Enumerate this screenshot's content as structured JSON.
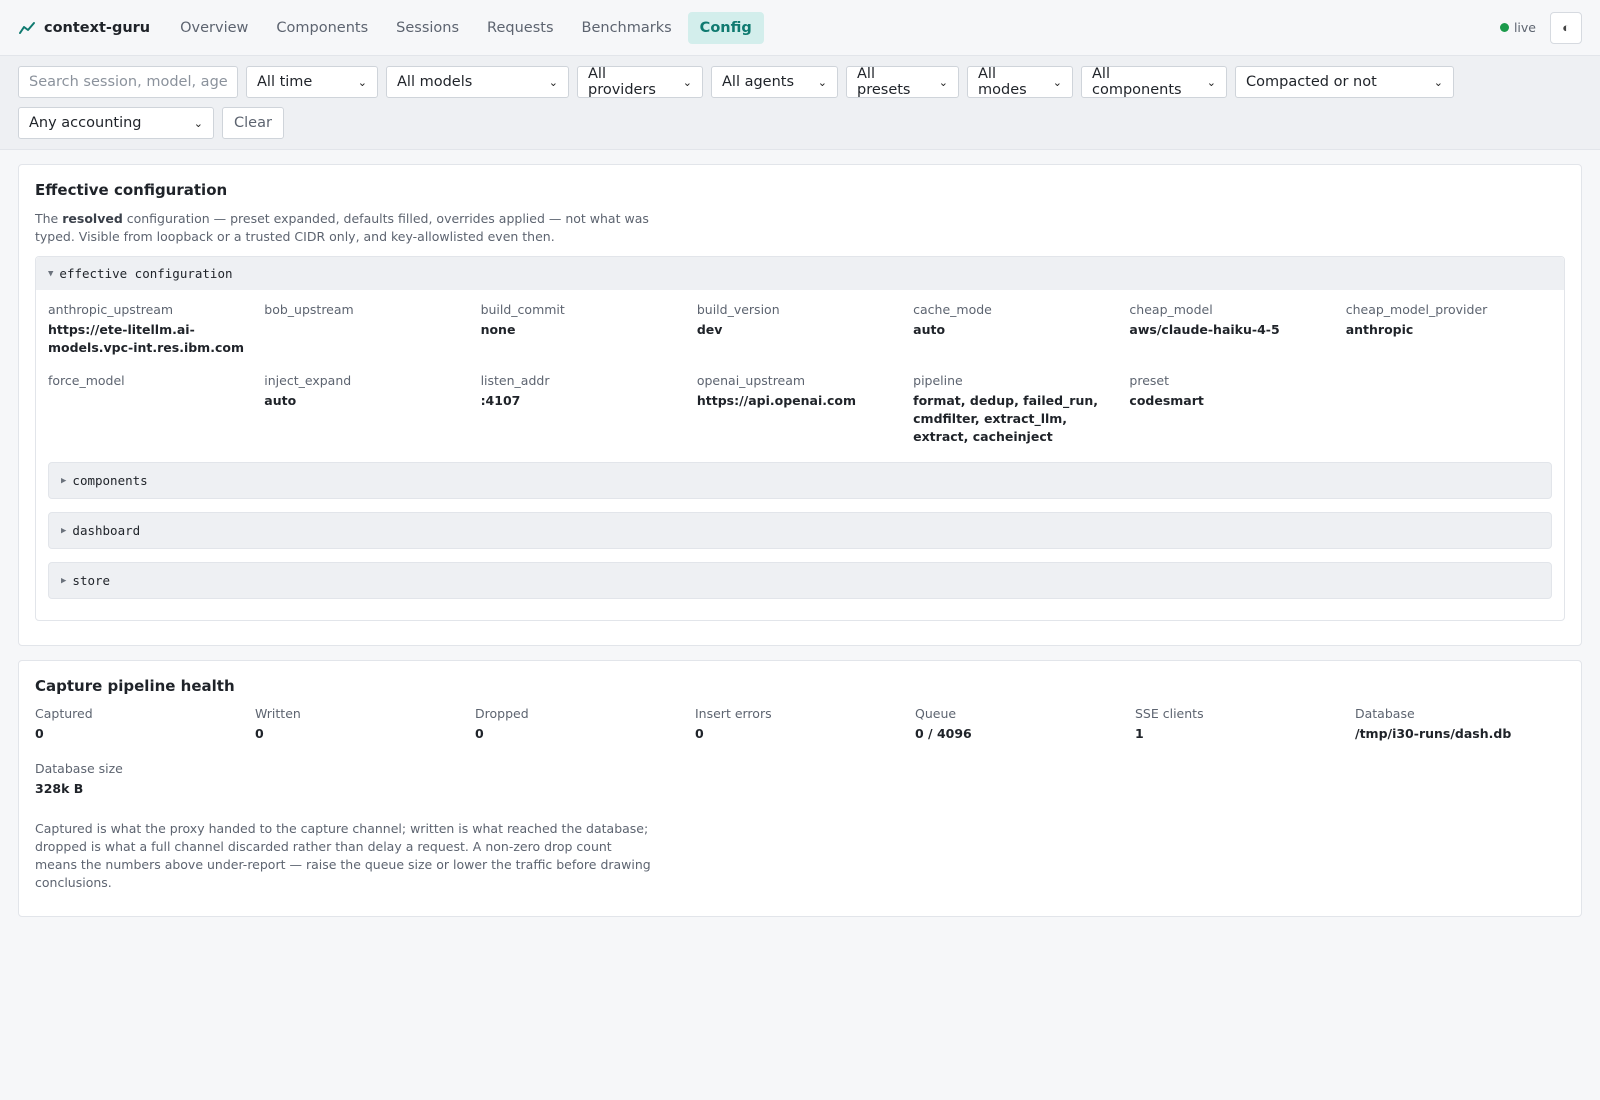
{
  "app": {
    "name": "context-guru"
  },
  "nav": [
    {
      "label": "Overview",
      "active": false
    },
    {
      "label": "Components",
      "active": false
    },
    {
      "label": "Sessions",
      "active": false
    },
    {
      "label": "Requests",
      "active": false
    },
    {
      "label": "Benchmarks",
      "active": false
    },
    {
      "label": "Config",
      "active": true
    }
  ],
  "status": {
    "live_label": "live",
    "theme_icon": "◐"
  },
  "filters": {
    "search_placeholder": "Search session, model, agent",
    "time": "All time",
    "models": "All models",
    "providers": "All providers",
    "agents": "All agents",
    "presets": "All presets",
    "modes": "All modes",
    "components": "All components",
    "compacted": "Compacted or not",
    "accounting": "Any accounting",
    "clear_label": "Clear"
  },
  "effective": {
    "title": "Effective configuration",
    "desc_pre": "The ",
    "desc_bold": "resolved",
    "desc_post": " configuration — preset expanded, defaults filled, overrides applied — not what was typed. Visible from loopback or a trusted CIDR only, and key-allowlisted even then.",
    "summary": "effective configuration",
    "fields": [
      {
        "k": "anthropic_upstream",
        "v": "https://ete-litellm.ai-models.vpc-int.res.ibm.com"
      },
      {
        "k": "bob_upstream",
        "v": ""
      },
      {
        "k": "build_commit",
        "v": "none"
      },
      {
        "k": "build_version",
        "v": "dev"
      },
      {
        "k": "cache_mode",
        "v": "auto"
      },
      {
        "k": "cheap_model",
        "v": "aws/claude-haiku-4-5"
      },
      {
        "k": "cheap_model_provider",
        "v": "anthropic"
      },
      {
        "k": "force_model",
        "v": ""
      },
      {
        "k": "inject_expand",
        "v": "auto"
      },
      {
        "k": "listen_addr",
        "v": ":4107"
      },
      {
        "k": "openai_upstream",
        "v": "https://api.openai.com"
      },
      {
        "k": "pipeline",
        "v": "format, dedup, failed_run, cmdfilter, extract_llm, extract, cacheinject"
      },
      {
        "k": "preset",
        "v": "codesmart"
      }
    ],
    "subsections": [
      "components",
      "dashboard",
      "store"
    ]
  },
  "health": {
    "title": "Capture pipeline health",
    "stats": [
      {
        "k": "Captured",
        "v": "0"
      },
      {
        "k": "Written",
        "v": "0"
      },
      {
        "k": "Dropped",
        "v": "0"
      },
      {
        "k": "Insert errors",
        "v": "0"
      },
      {
        "k": "Queue",
        "v": "0 / 4096"
      },
      {
        "k": "SSE clients",
        "v": "1"
      },
      {
        "k": "Database",
        "v": "/tmp/i30-runs/dash.db"
      },
      {
        "k": "Database size",
        "v": "328k B"
      }
    ],
    "desc": "Captured is what the proxy handed to the capture channel; written is what reached the database; dropped is what a full channel discarded rather than delay a request. A non-zero drop count means the numbers above under-report — raise the queue size or lower the traffic before drawing conclusions."
  }
}
